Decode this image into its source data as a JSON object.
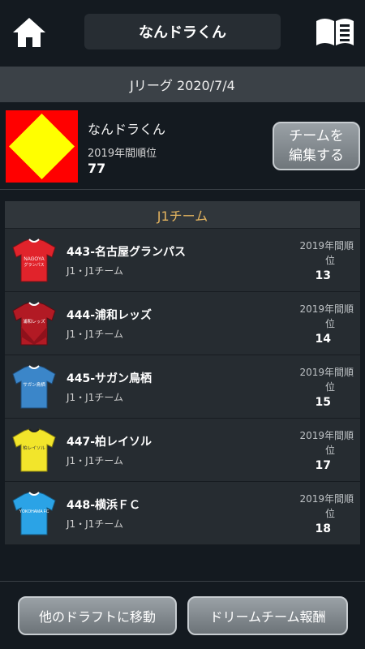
{
  "header": {
    "title": "なんドラくん",
    "home_icon": "home-icon",
    "book_icon": "book-icon"
  },
  "league_bar": {
    "text": "Jリーグ 2020/7/4"
  },
  "user": {
    "name": "なんドラくん",
    "rank_label": "2019年間順位",
    "rank_value": "77",
    "flag_colors": {
      "background": "#ff0000",
      "diamond": "#ffff00"
    },
    "edit_button": {
      "line1": "チームを",
      "line2": "編集する"
    }
  },
  "teams_section": {
    "header": "J1チーム",
    "rank_label_line1": "2019年間順",
    "rank_label_line2": "位",
    "items": [
      {
        "name": "443-名古屋グランパス",
        "league": "J1・J1チーム",
        "rank": "13",
        "jersey_text1": "NAGOYA",
        "jersey_text2": "グランパス",
        "color": "#e1232b"
      },
      {
        "name": "444-浦和レッズ",
        "league": "J1・J1チーム",
        "rank": "14",
        "jersey_text1": "浦和レッズ",
        "jersey_text2": "",
        "color": "#b21a24"
      },
      {
        "name": "445-サガン鳥栖",
        "league": "J1・J1チーム",
        "rank": "15",
        "jersey_text1": "サガン鳥栖",
        "jersey_text2": "",
        "color": "#3b86c9"
      },
      {
        "name": "447-柏レイソル",
        "league": "J1・J1チーム",
        "rank": "17",
        "jersey_text1": "柏レイソル",
        "jersey_text2": "",
        "color": "#f2e52b"
      },
      {
        "name": "448-横浜ＦＣ",
        "league": "J1・J1チーム",
        "rank": "18",
        "jersey_text1": "YOKOHAMA FC",
        "jersey_text2": "",
        "color": "#2ba3e6"
      }
    ]
  },
  "footer": {
    "left_button": "他のドラフトに移動",
    "right_button": "ドリームチーム報酬"
  }
}
